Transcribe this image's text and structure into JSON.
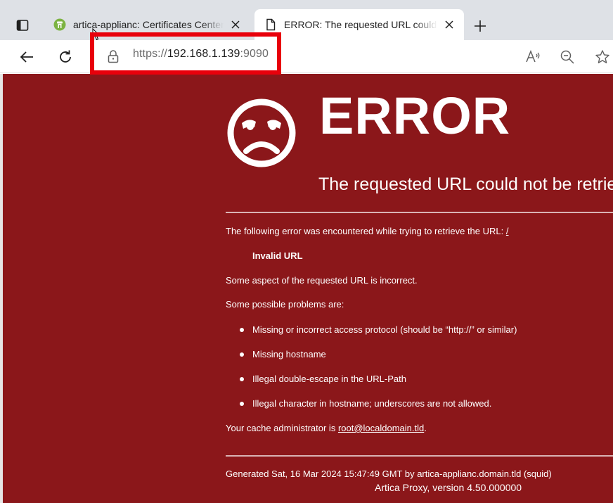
{
  "browser": {
    "tabs": [
      {
        "title": "artica-applianc: Certificates Center",
        "active": false,
        "favicon": "artica-favicon-icon"
      },
      {
        "title": "ERROR: The requested URL could not be retrieved",
        "active": true,
        "favicon": "document-icon"
      }
    ],
    "address": {
      "scheme": "https://",
      "host": "192.168.1.139",
      "port": ":9090"
    },
    "highlight_color": "#e8000b"
  },
  "page": {
    "background_color": "#8b171a",
    "title": "ERROR",
    "subtitle": "The requested URL could not be retrieved",
    "intro_text": "The following error was encountered while trying to retrieve the URL: ",
    "intro_link": "/",
    "error_name": "Invalid URL",
    "description": "Some aspect of the requested URL is incorrect.",
    "problems_heading": "Some possible problems are:",
    "problems": [
      "Missing or incorrect access protocol (should be “http://” or similar)",
      "Missing hostname",
      "Illegal double-escape in the URL-Path",
      "Illegal character in hostname; underscores are not allowed."
    ],
    "admin_prefix": "Your cache administrator is ",
    "admin_email": "root@localdomain.tld",
    "admin_suffix": ".",
    "generated": "Generated Sat, 16 Mar 2024 15:47:49 GMT by artica-applianc.domain.tld (squid)",
    "version": "Artica Proxy, version 4.50.000000"
  }
}
